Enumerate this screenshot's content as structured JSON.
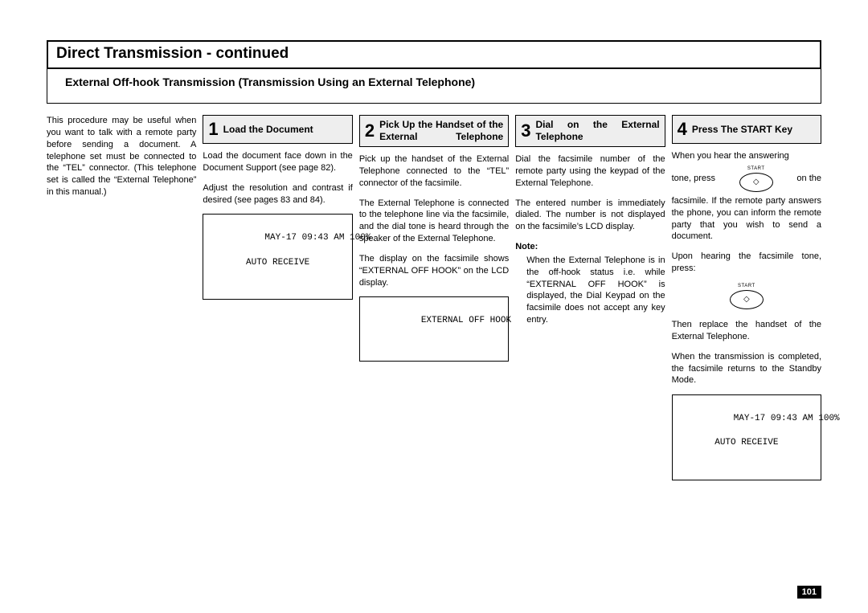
{
  "page_number": "101",
  "title": "Direct Transmission - continued",
  "subtitle": "External Off-hook Transmission (Transmission Using an External Telephone)",
  "intro": "This procedure may be useful when you want to talk with a remote party before sending a document. A telephone set must be connected to the “TEL” connector. (This telephone set is called the “External Telephone” in this manual.)",
  "steps": {
    "s1": {
      "num": "1",
      "title": "Load the Document",
      "p1": "Load the document face down in the Document Support (see page 82).",
      "p2": "Adjust the resolution and contrast if desired (see pages 83 and 84).",
      "lcd_line1": "MAY-17 09:43 AM 100%",
      "lcd_line2": "AUTO RECEIVE"
    },
    "s2": {
      "num": "2",
      "title": "Pick Up the Handset of the External Telephone",
      "p1": "Pick up the handset of the External Telephone connected to the “TEL” connector of the facsimile.",
      "p2": "The External Telephone is connected to the telephone line via the facsimile, and the dial tone is heard through the speaker of the External Telephone.",
      "p3": "The display on the facsimile shows “EXTERNAL OFF HOOK” on the LCD display.",
      "lcd_line1": "EXTERNAL OFF HOOK"
    },
    "s3": {
      "num": "3",
      "title": "Dial on the External Telephone",
      "p1": "Dial the facsimile number of the remote party using the keypad of the External Telephone.",
      "p2": "The entered number is immediately dialed. The number is not displayed on the facsimile’s LCD display.",
      "note_label": "Note:",
      "note_body": "When the External Telephone is in the off-hook status i.e. while “EXTERNAL OFF HOOK” is displayed, the Dial Keypad on the facsimile does not accept any key entry."
    },
    "s4": {
      "num": "4",
      "title": "Press The START Key",
      "p1a": "When you hear the answering",
      "p1b_left": "tone, press",
      "p1b_right": "on the",
      "p2": "facsimile. If the remote party answers the phone, you can inform the remote party that you wish to send a document.",
      "p3": "Upon hearing the facsimile tone, press:",
      "p4": "Then replace the handset of the External Telephone.",
      "p5": "When the transmission is completed, the facsimile returns to the Standby Mode.",
      "lcd_line1": "MAY-17 09:43 AM 100%",
      "lcd_line2": "AUTO RECEIVE",
      "start_label": "START",
      "start_glyph": "◇"
    }
  }
}
